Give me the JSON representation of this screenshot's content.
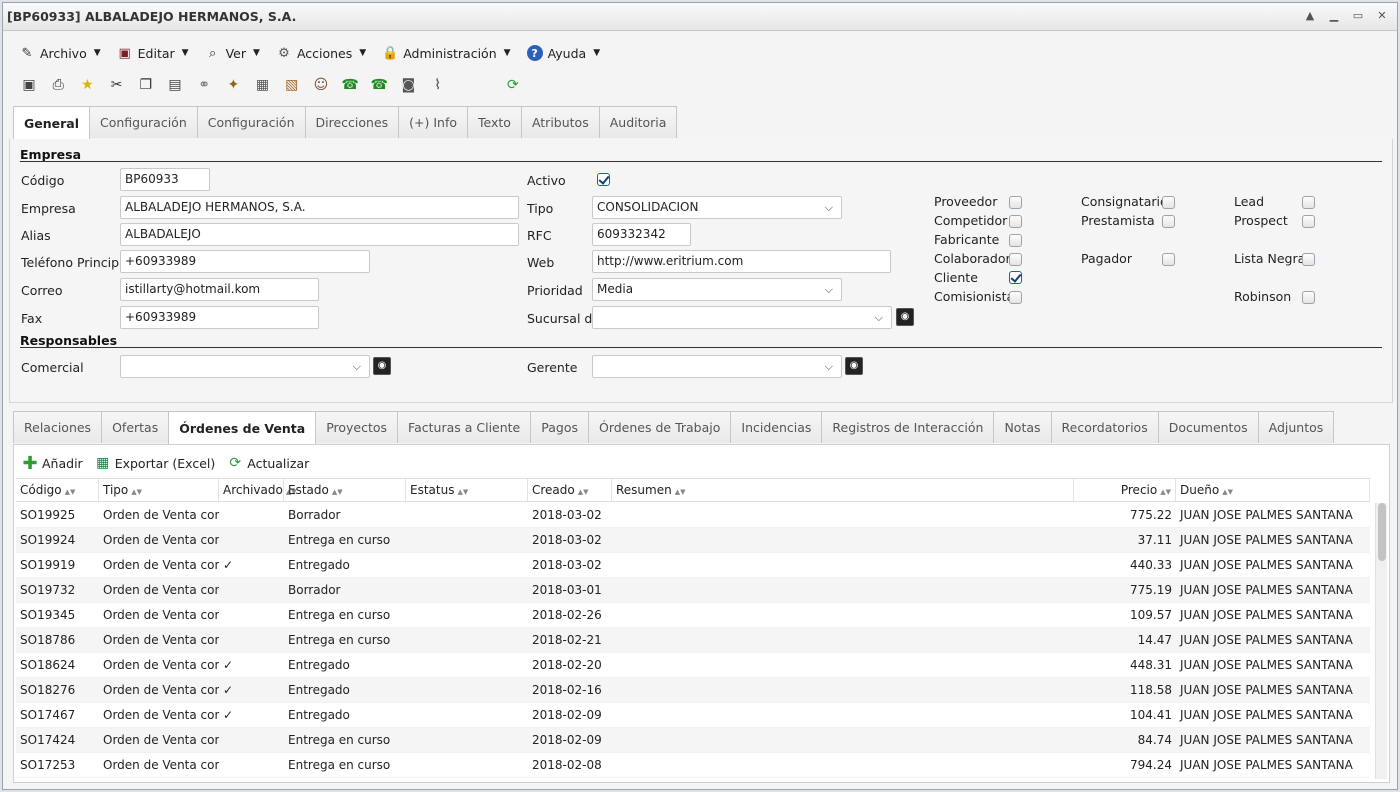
{
  "window": {
    "title": "[BP60933] ALBALADEJO HERMANOS, S.A."
  },
  "menu": [
    {
      "label": "Archivo",
      "icon": "archive-icon"
    },
    {
      "label": "Editar",
      "icon": "edit-icon"
    },
    {
      "label": "Ver",
      "icon": "view-icon"
    },
    {
      "label": "Acciones",
      "icon": "actions-icon"
    },
    {
      "label": "Administración",
      "icon": "lock-icon"
    },
    {
      "label": "Ayuda",
      "icon": "help-icon"
    }
  ],
  "toolbar": [
    "save-icon",
    "print-icon",
    "favorite-icon",
    "cut-icon",
    "copy-icon",
    "paste-icon",
    "link-icon",
    "process-icon",
    "calculator-icon",
    "report-icon",
    "users-icon",
    "phone-in-icon",
    "phone-out-icon",
    "camera-icon",
    "attach-icon",
    "refresh-icon"
  ],
  "tabs_top": [
    "General",
    "Configuración",
    "Configuración",
    "Direcciones",
    "(+) Info",
    "Texto",
    "Atributos",
    "Auditoria"
  ],
  "sections": {
    "empresa": "Empresa",
    "responsables": "Responsables"
  },
  "form": {
    "codigo": {
      "label": "Código",
      "value": "BP60933"
    },
    "empresa": {
      "label": "Empresa",
      "value": "ALBALADEJO HERMANOS, S.A."
    },
    "alias": {
      "label": "Alias",
      "value": "ALBADALEJO"
    },
    "telefono": {
      "label": "Teléfono Principal",
      "value": "+60933989"
    },
    "correo": {
      "label": "Correo",
      "value": "istillarty@hotmail.kom"
    },
    "fax": {
      "label": "Fax",
      "value": "+60933989"
    },
    "activo": {
      "label": "Activo",
      "checked": true
    },
    "tipo": {
      "label": "Tipo",
      "value": "CONSOLIDACION"
    },
    "rfc": {
      "label": "RFC",
      "value": "609332342"
    },
    "web": {
      "label": "Web",
      "value": "http://www.eritrium.com"
    },
    "prioridad": {
      "label": "Prioridad",
      "value": "Media"
    },
    "sucursal": {
      "label": "Sucursal de",
      "value": ""
    },
    "comercial": {
      "label": "Comercial",
      "value": ""
    },
    "gerente": {
      "label": "Gerente",
      "value": ""
    }
  },
  "flags": [
    {
      "label": "Proveedor",
      "checked": false
    },
    {
      "label": "Competidor",
      "checked": false
    },
    {
      "label": "Fabricante",
      "checked": false
    },
    {
      "label": "Colaborador",
      "checked": false
    },
    {
      "label": "Cliente",
      "checked": true
    },
    {
      "label": "Comisionista",
      "checked": false
    },
    {
      "label": "Consignatario",
      "checked": false
    },
    {
      "label": "Prestamista",
      "checked": false
    },
    {
      "label": "Pagador",
      "checked": false
    },
    {
      "label": "Lead",
      "checked": false
    },
    {
      "label": "Prospect",
      "checked": false
    },
    {
      "label": "Lista Negra",
      "checked": false
    },
    {
      "label": "Robinson",
      "checked": false
    }
  ],
  "tabs_bottom": [
    "Relaciones",
    "Ofertas",
    "Órdenes de Venta",
    "Proyectos",
    "Facturas a Cliente",
    "Pagos",
    "Órdenes de Trabajo",
    "Incidencias",
    "Registros de Interacción",
    "Notas",
    "Recordatorios",
    "Documentos",
    "Adjuntos"
  ],
  "grid_toolbar": {
    "add": "Añadir",
    "export": "Exportar (Excel)",
    "refresh": "Actualizar"
  },
  "columns": [
    "Código",
    "Tipo",
    "Archivado",
    "Estado",
    "Estatus",
    "Creado",
    "Resumen",
    "Precio",
    "Dueño"
  ],
  "rows": [
    {
      "codigo": "SO19925",
      "tipo": "Orden de Venta con P",
      "archivado": "",
      "estado": "Borrador",
      "estatus": "",
      "creado": "2018-03-02",
      "resumen": "",
      "precio": "775.22",
      "dueno": "JUAN JOSE PALMES SANTANA"
    },
    {
      "codigo": "SO19924",
      "tipo": "Orden de Venta con P",
      "archivado": "",
      "estado": "Entrega en curso",
      "estatus": "",
      "creado": "2018-03-02",
      "resumen": "",
      "precio": "37.11",
      "dueno": "JUAN JOSE PALMES SANTANA"
    },
    {
      "codigo": "SO19919",
      "tipo": "Orden de Venta con P",
      "archivado": "✓",
      "estado": "Entregado",
      "estatus": "",
      "creado": "2018-03-02",
      "resumen": "",
      "precio": "440.33",
      "dueno": "JUAN JOSE PALMES SANTANA"
    },
    {
      "codigo": "SO19732",
      "tipo": "Orden de Venta con P",
      "archivado": "",
      "estado": "Borrador",
      "estatus": "",
      "creado": "2018-03-01",
      "resumen": "",
      "precio": "775.19",
      "dueno": "JUAN JOSE PALMES SANTANA"
    },
    {
      "codigo": "SO19345",
      "tipo": "Orden de Venta con P",
      "archivado": "",
      "estado": "Entrega en curso",
      "estatus": "",
      "creado": "2018-02-26",
      "resumen": "",
      "precio": "109.57",
      "dueno": "JUAN JOSE PALMES SANTANA"
    },
    {
      "codigo": "SO18786",
      "tipo": "Orden de Venta con P",
      "archivado": "",
      "estado": "Entrega en curso",
      "estatus": "",
      "creado": "2018-02-21",
      "resumen": "",
      "precio": "14.47",
      "dueno": "JUAN JOSE PALMES SANTANA"
    },
    {
      "codigo": "SO18624",
      "tipo": "Orden de Venta con P",
      "archivado": "✓",
      "estado": "Entregado",
      "estatus": "",
      "creado": "2018-02-20",
      "resumen": "",
      "precio": "448.31",
      "dueno": "JUAN JOSE PALMES SANTANA"
    },
    {
      "codigo": "SO18276",
      "tipo": "Orden de Venta con P",
      "archivado": "✓",
      "estado": "Entregado",
      "estatus": "",
      "creado": "2018-02-16",
      "resumen": "",
      "precio": "118.58",
      "dueno": "JUAN JOSE PALMES SANTANA"
    },
    {
      "codigo": "SO17467",
      "tipo": "Orden de Venta con P",
      "archivado": "✓",
      "estado": "Entregado",
      "estatus": "",
      "creado": "2018-02-09",
      "resumen": "",
      "precio": "104.41",
      "dueno": "JUAN JOSE PALMES SANTANA"
    },
    {
      "codigo": "SO17424",
      "tipo": "Orden de Venta con P",
      "archivado": "",
      "estado": "Entrega en curso",
      "estatus": "",
      "creado": "2018-02-09",
      "resumen": "",
      "precio": "84.74",
      "dueno": "JUAN JOSE PALMES SANTANA"
    },
    {
      "codigo": "SO17253",
      "tipo": "Orden de Venta con P",
      "archivado": "",
      "estado": "Entrega en curso",
      "estatus": "",
      "creado": "2018-02-08",
      "resumen": "",
      "precio": "794.24",
      "dueno": "JUAN JOSE PALMES SANTANA"
    }
  ]
}
